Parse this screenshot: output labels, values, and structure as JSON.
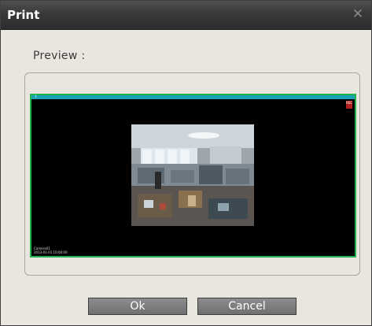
{
  "dialog": {
    "title": "Print",
    "close_glyph": "✕",
    "preview_label": "Preview :"
  },
  "preview": {
    "camera_channel": "1",
    "rec_flag": "REC",
    "camera_name": "Camera01",
    "timestamp": "2013-01-01 10:00:00"
  },
  "buttons": {
    "ok": "Ok",
    "cancel": "Cancel"
  },
  "colors": {
    "titlebar": "#393939",
    "dialog_bg": "#e8e6df",
    "screen_border": "#1fb24a",
    "screen_topbar": "#1ba3b4"
  },
  "icons": {
    "close": "close-icon"
  }
}
